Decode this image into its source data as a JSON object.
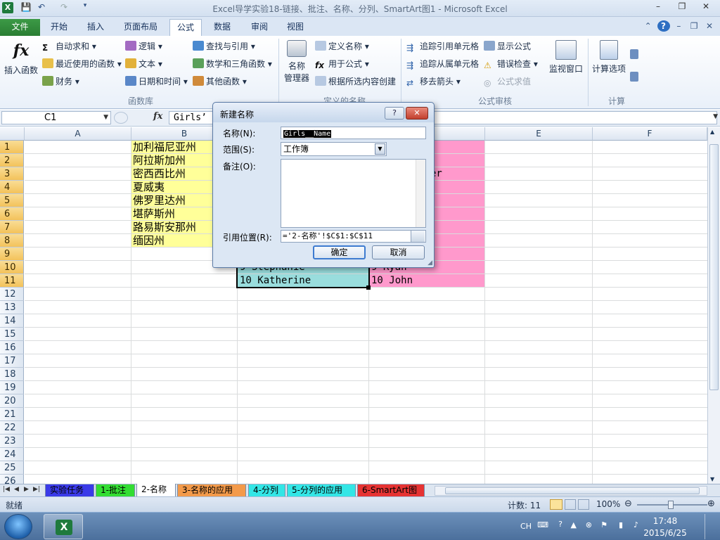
{
  "window": {
    "title": "Excel导学实验18-链接、批注、名称、分列、SmartArt图1 - Microsoft Excel"
  },
  "ribbon_tabs": [
    "文件",
    "开始",
    "插入",
    "页面布局",
    "公式",
    "数据",
    "审阅",
    "视图"
  ],
  "active_tab": "公式",
  "ribbon": {
    "insert_function": "插入函数",
    "function_library": {
      "label": "函数库",
      "autosum": "自动求和",
      "recent": "最近使用的函数",
      "financial": "财务",
      "logical": "逻辑",
      "text": "文本",
      "datetime": "日期和时间",
      "lookup": "查找与引用",
      "math": "数学和三角函数",
      "more": "其他函数"
    },
    "defined_names": {
      "label": "定义的名称",
      "manager_1": "名称",
      "manager_2": "管理器",
      "define": "定义名称",
      "use_in_formula": "用于公式",
      "create_from_selection": "根据所选内容创建"
    },
    "formula_auditing": {
      "label": "公式审核",
      "trace_precedents": "追踪引用单元格",
      "trace_dependents": "追踪从属单元格",
      "remove_arrows": "移去箭头",
      "show_formulas": "显示公式",
      "error_checking": "错误检查",
      "evaluate": "公式求值",
      "watch_window": "监视窗口"
    },
    "calculation": {
      "label": "计算",
      "options": "计算选项"
    }
  },
  "formula_bar": {
    "name_box": "C1",
    "fx": "fx",
    "formula": "Girls’"
  },
  "grid": {
    "columns": [
      "A",
      "B",
      "C",
      "D",
      "E",
      "F"
    ],
    "rows": [
      "1",
      "2",
      "3",
      "4",
      "5",
      "6",
      "7",
      "8",
      "9",
      "10",
      "11",
      "12",
      "13",
      "14",
      "15",
      "16",
      "17",
      "18",
      "19",
      "20",
      "21",
      "22",
      "23",
      "24",
      "25",
      "26"
    ],
    "col_b": [
      "加利福尼亚州",
      "阿拉斯加州",
      "密西西比州",
      "夏威夷",
      "佛罗里达州",
      "堪萨斯州",
      "路易斯安那州",
      "缅因州"
    ],
    "c10": "9 Stephanie",
    "c11": "10 Katherine",
    "d3": "er",
    "d10": "9 Ryan",
    "d11": "10 John"
  },
  "sheet_tabs": [
    {
      "label": "实验任务",
      "color": "#3a3ae8"
    },
    {
      "label": "1-批注",
      "color": "#33dd33"
    },
    {
      "label": "2-名称",
      "color": "#ffffff"
    },
    {
      "label": "3-名称的应用",
      "color": "#f39a4a"
    },
    {
      "label": "4-分列",
      "color": "#33e6e6"
    },
    {
      "label": "5-分列的应用",
      "color": "#33e6e6"
    },
    {
      "label": "6-SmartArt图",
      "color": "#e63333"
    }
  ],
  "status": {
    "ready": "就绪",
    "count": "计数: 11",
    "zoom": "100%"
  },
  "taskbar": {
    "lang": "CH",
    "time": "17:48",
    "date": "2015/6/25"
  },
  "dialog": {
    "title": "新建名称",
    "help": "?",
    "close": "✕",
    "name_label": "名称(N):",
    "name_value": "Girls__Name",
    "scope_label": "范围(S):",
    "scope_value": "工作簿",
    "comment_label": "备注(O):",
    "ref_label": "引用位置(R):",
    "ref_value": "='2-名称'!$C$1:$C$11",
    "ok": "确定",
    "cancel": "取消"
  },
  "colors": {
    "yellow_fill": "#ffff99",
    "cyan_fill": "#99dddd",
    "pink_fill": "#ff99cc",
    "row_header_selected": "#f3c25a"
  }
}
